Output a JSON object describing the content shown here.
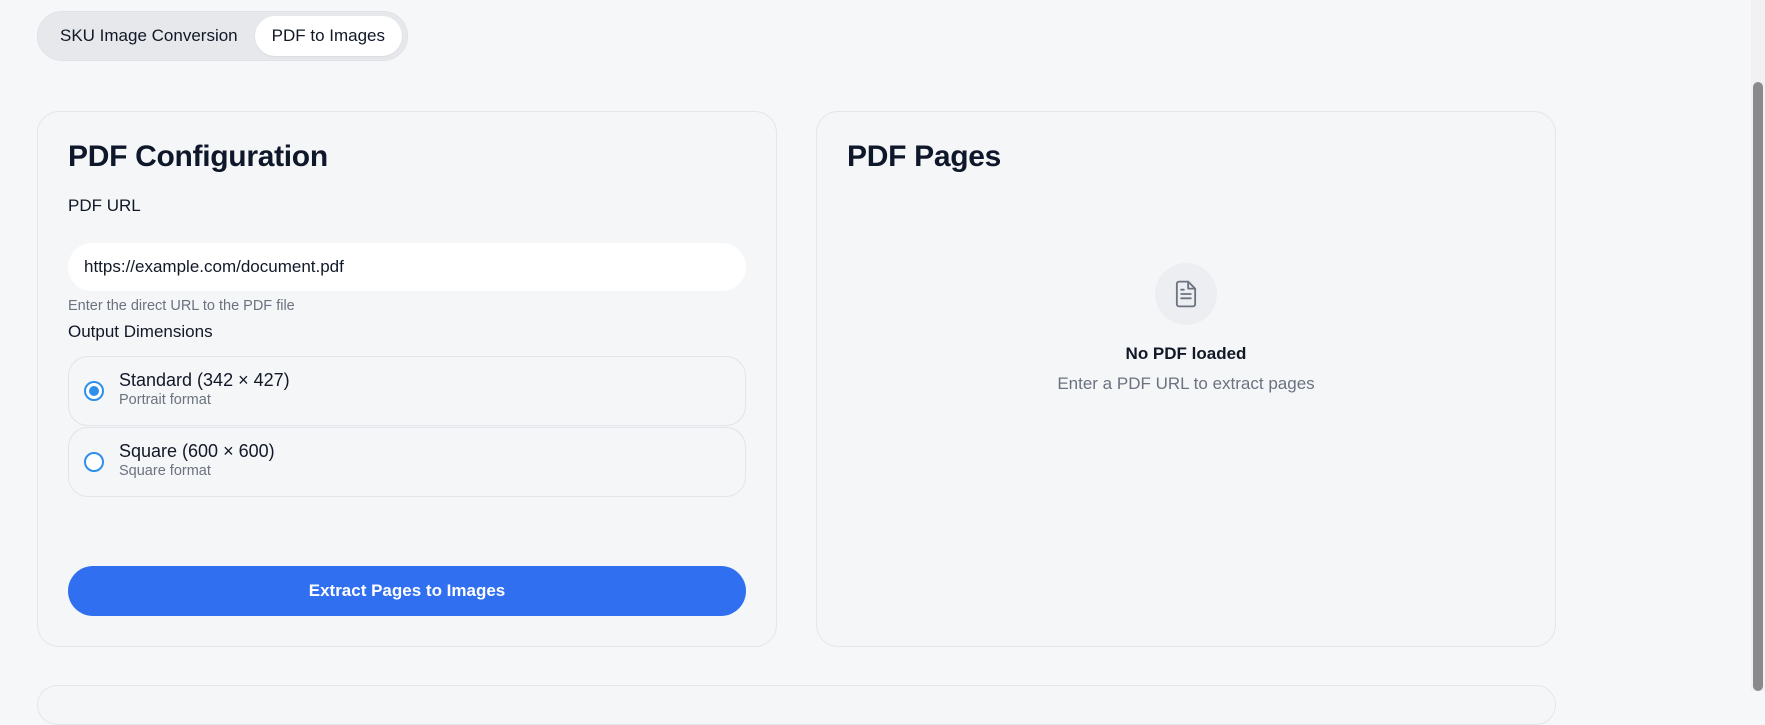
{
  "tabs": [
    {
      "label": "SKU Image Conversion",
      "active": false
    },
    {
      "label": "PDF to Images",
      "active": true
    }
  ],
  "config": {
    "title": "PDF Configuration",
    "url_label": "PDF URL",
    "url_value": "https://example.com/document.pdf",
    "url_hint": "Enter the direct URL to the PDF file",
    "dimensions_label": "Output Dimensions",
    "options": [
      {
        "label": "Standard (342 × 427)",
        "sub": "Portrait format",
        "selected": true
      },
      {
        "label": "Square (600 × 600)",
        "sub": "Square format",
        "selected": false
      }
    ],
    "extract_button": "Extract Pages to Images"
  },
  "pages": {
    "title": "PDF Pages",
    "empty_title": "No PDF loaded",
    "empty_sub": "Enter a PDF URL to extract pages",
    "empty_icon": "document-icon"
  },
  "colors": {
    "accent": "#2f6ff0",
    "radio": "#2f8fe8",
    "background": "#f6f7f9"
  }
}
